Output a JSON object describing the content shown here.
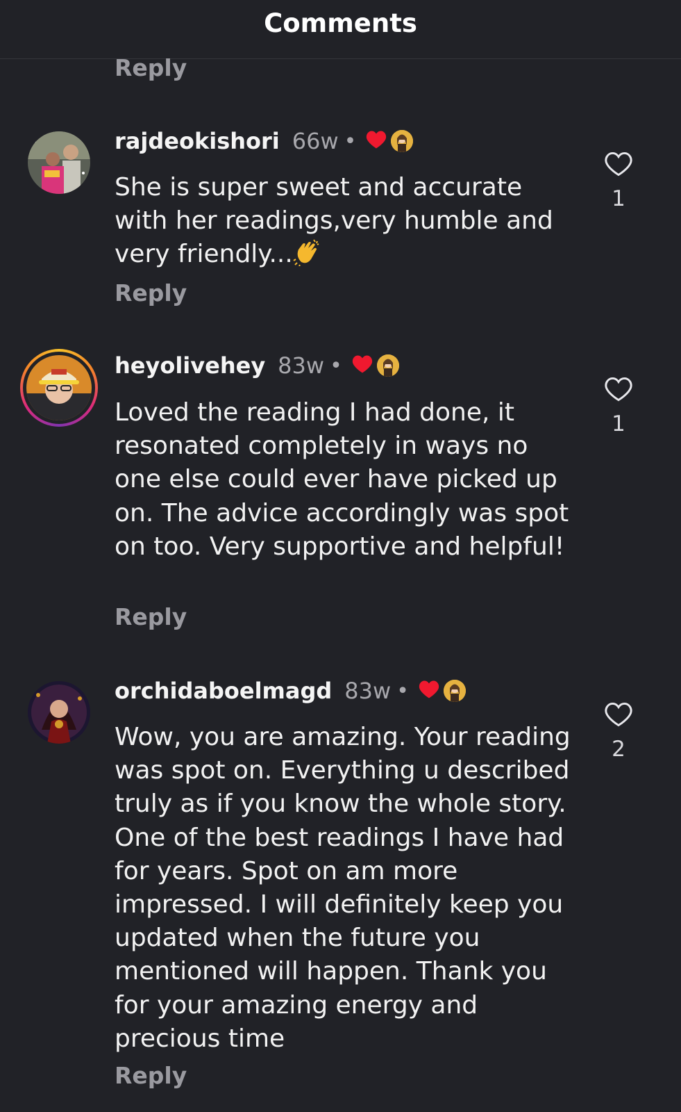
{
  "header": {
    "title": "Comments"
  },
  "top_reply_label": "Reply",
  "comments": [
    {
      "username": "rajdeokishori",
      "time": "66w",
      "separator": "•",
      "text": "She is  super sweet and accurate with her readings,very humble and very friendly...",
      "emoji": "clapping-hands",
      "likes": "1",
      "reply_label": "Reply",
      "liked_by_creator": true
    },
    {
      "username": "heyolivehey",
      "time": "83w",
      "separator": "•",
      "text": "Loved the reading I had done, it resonated completely in ways no one else could ever have picked up on. The advice accordingly was spot on too. Very supportive and helpful!",
      "likes": "1",
      "reply_label": "Reply",
      "liked_by_creator": true,
      "has_story_ring": true
    },
    {
      "username": "orchidaboelmagd",
      "time": "83w",
      "separator": "•",
      "text": "Wow, you are amazing. Your reading was spot on. Everything u described truly as if you know the whole story. One of the best readings I have had for years. Spot on am more impressed. I will definitely keep you updated when the future you mentioned will happen. Thank you for your amazing energy and precious time",
      "likes": "2",
      "reply_label": "Reply",
      "liked_by_creator": true
    }
  ],
  "colors": {
    "background": "#212227",
    "heart_red": "#f0192f",
    "muted_text": "#a8a8ad"
  },
  "icons": {
    "like": "heart-outline-icon",
    "creator_like": "heart-filled-icon"
  }
}
